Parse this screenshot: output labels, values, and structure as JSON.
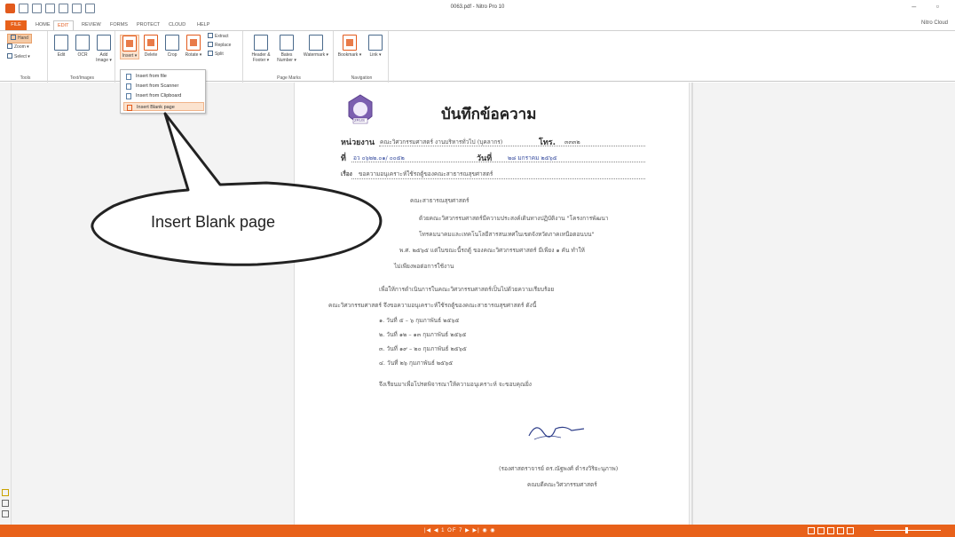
{
  "window": {
    "title": "0063.pdf - Nitro Pro 10",
    "controls": "– ▫"
  },
  "menu": {
    "tabs": [
      "FILE",
      "HOME",
      "EDIT",
      "REVIEW",
      "FORMS",
      "PROTECT",
      "CLOUD",
      "HELP"
    ],
    "active": "EDIT",
    "account": "Nitro Cloud"
  },
  "ribbon": {
    "tools": {
      "hand": "Hand",
      "zoom": "Zoom ▾",
      "select": "Select ▾",
      "label": "Tools"
    },
    "text_images": {
      "edit": "Edit",
      "ocr": "OCR",
      "add_image": "Add Image ▾",
      "label": "Text/Images"
    },
    "pages": {
      "insert": "Insert ▾",
      "delete": "Delete",
      "crop": "Crop",
      "rotate": "Rotate ▾",
      "extract": "Extract",
      "replace": "Replace",
      "split": "Split"
    },
    "page_marks": {
      "header_footer": "Header & Footer ▾",
      "bates_number": "Bates Number ▾",
      "watermark": "Watermark ▾",
      "label": "Page Marks"
    },
    "navigation": {
      "bookmark": "Bookmark ▾",
      "link": "Link ▾",
      "label": "Navigation"
    }
  },
  "insert_menu": {
    "items": [
      "Insert from file",
      "Insert from Scanner",
      "Insert from Clipboard",
      "Insert Blank page"
    ],
    "selected": "Insert Blank page"
  },
  "callout": {
    "text": "Insert Blank page"
  },
  "document": {
    "heading": "บันทึกข้อความ",
    "logo_text": "2RUS",
    "agency_label": "หน่วยงาน",
    "agency_value": "คณะวิศวกรรมศาสตร์ งานบริหารทั่วไป (บุคลากร)",
    "tel_label": "โทร.",
    "tel_value": "๓๓๓๒",
    "ref_label": "ที่",
    "ref_value": "อว ๐๖๒๒.๐๑/ ๐๐๕๒",
    "date_label": "วันที่",
    "date_value": "๒๘ มกราคม ๒๕๖๕",
    "subject_prefix": "เรื่อง",
    "subject": "ขอความอนุเคราะห์ใช้รถตู้ของคณะสาธารณสุขศาสตร์",
    "to_line": "คณะสาธารณสุขศาสตร์",
    "para1": [
      "ด้วยคณะวิศวกรรมศาสตร์มีความประสงค์เดินทางปฏิบัติงาน \"โครงการพัฒนา",
      "โทรคมนาคมและเทคโนโลยีสารสนเทศในเขตจังหวัดภาคเหนือตอนบน\"",
      "พ.ศ. ๒๕๖๕ แต่ในขณะนี้รถตู้ ของคณะวิศวกรรมศาสตร์ มีเพียง ๑ คัน ทำให้",
      "ไม่เพียงพอต่อการใช้งาน"
    ],
    "para2": [
      "เพื่อให้การดำเนินการในคณะวิศวกรรมศาสตร์เป็นไปด้วยความเรียบร้อย",
      "คณะวิศวกรรมศาสตร์ จึงขอความอนุเคราะห์ใช้รถตู้ของคณะสาธารณสุขศาสตร์ ดังนี้"
    ],
    "dates": [
      "๑. วันที่ ๕ – ๖ กุมภาพันธ์ ๒๕๖๕",
      "๒. วันที่ ๑๒ – ๑๓ กุมภาพันธ์ ๒๕๖๕",
      "๓. วันที่ ๑๙ – ๒๐ กุมภาพันธ์ ๒๕๖๕",
      "๔. วันที่ ๒๖ กุมภาพันธ์ ๒๕๖๕"
    ],
    "closing": "จึงเรียนมาเพื่อโปรดพิจารณาให้ความอนุเคราะห์ จะขอบคุณยิ่ง",
    "signer_name": "(รองศาสตราจารย์ ดร.ณัฐพงศ์ ดำรงวิริยะนุภาพ)",
    "signer_title": "คณบดีคณะวิศวกรรมศาสตร์"
  },
  "status": {
    "page_indicator": "1 OF 7"
  }
}
